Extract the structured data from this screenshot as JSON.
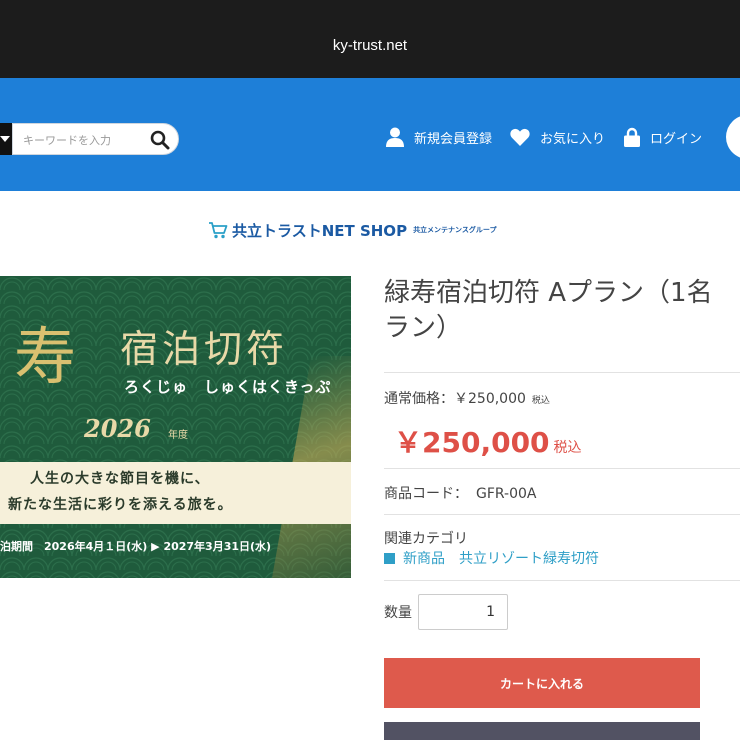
{
  "browser": {
    "url": "ky-trust.net"
  },
  "header": {
    "search_placeholder": "キーワードを入力",
    "nav": {
      "register": "新規会員登録",
      "favorites": "お気に入り",
      "login": "ログイン"
    }
  },
  "logo": {
    "name": "共立トラストNET SHOP",
    "sub": "共立メンテナンスグループ"
  },
  "banner": {
    "kotobuki": "寿",
    "title": "宿泊切符",
    "reading": "ろくじゅ　しゅくはくきっぷ",
    "year": "2026",
    "year_suffix": "年度",
    "copy_line1": "人生の大きな節目を機に、",
    "copy_line2": "新たな生活に彩りを添える旅を。",
    "period": "泊期間　2026年4月１日(水) ▶ 2027年3月31日(水)"
  },
  "product": {
    "title_line1": "緑寿宿泊切符 Aプラン（1名",
    "title_line2": "ラン）",
    "regular_price_label": "通常価格：￥250,000",
    "regular_price_tax": "税込",
    "sale_price": "￥250,000",
    "sale_price_tax": "税込",
    "code_label": "商品コード：",
    "code_value": "GFR-00A",
    "category_label": "関連カテゴリ",
    "categories": [
      "新商品",
      "共立リゾート緑寿切符"
    ],
    "quantity_label": "数量",
    "quantity_value": "1",
    "add_to_cart": "カートに入れる"
  },
  "colors": {
    "header_blue": "#1e7fd8",
    "price_red": "#de5047",
    "cart_button": "#de5a4c",
    "link_blue": "#2f9fc7",
    "dark_button": "#525263"
  }
}
